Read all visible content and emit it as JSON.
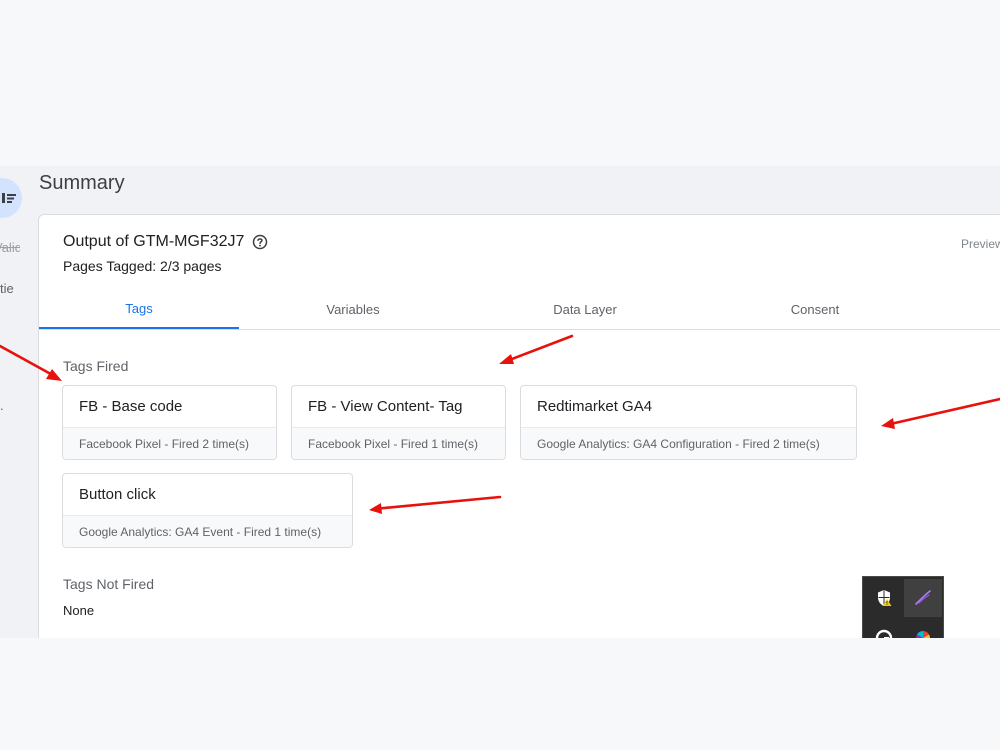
{
  "sidebar": {
    "items": [
      {
        "label": "Valid",
        "strikethrough": true
      },
      {
        "label": "tie"
      },
      {
        "label": "."
      }
    ]
  },
  "summary": {
    "title": "Summary"
  },
  "output": {
    "title": "Output of GTM-MGF32J7",
    "pages_tagged": "Pages Tagged: 2/3 pages",
    "preview_label": "Preview"
  },
  "tabs": [
    {
      "label": "Tags",
      "active": true
    },
    {
      "label": "Variables"
    },
    {
      "label": "Data Layer"
    },
    {
      "label": "Consent"
    }
  ],
  "tags_fired": {
    "label": "Tags Fired",
    "items": [
      {
        "name": "FB - Base code",
        "status": "Facebook Pixel - Fired 2 time(s)"
      },
      {
        "name": "FB - View Content- Tag",
        "status": "Facebook Pixel - Fired 1 time(s)"
      },
      {
        "name": "Redtimarket GA4",
        "status": "Google Analytics: GA4 Configuration - Fired 2 time(s)"
      },
      {
        "name": "Button click",
        "status": "Google Analytics: GA4 Event - Fired 1 time(s)"
      }
    ]
  },
  "tags_not_fired": {
    "label": "Tags Not Fired",
    "value": "None"
  },
  "colors": {
    "accent": "#1a73e8",
    "annotation_arrow": "#e8120c",
    "tray_bg": "#2b2b2b"
  },
  "icons": {
    "rail": "filter-list-icon",
    "help": "help-circle-icon",
    "tray": [
      "defender-warning-icon",
      "feather-pen-icon",
      "grammarly-icon",
      "color-wheel-icon"
    ]
  }
}
